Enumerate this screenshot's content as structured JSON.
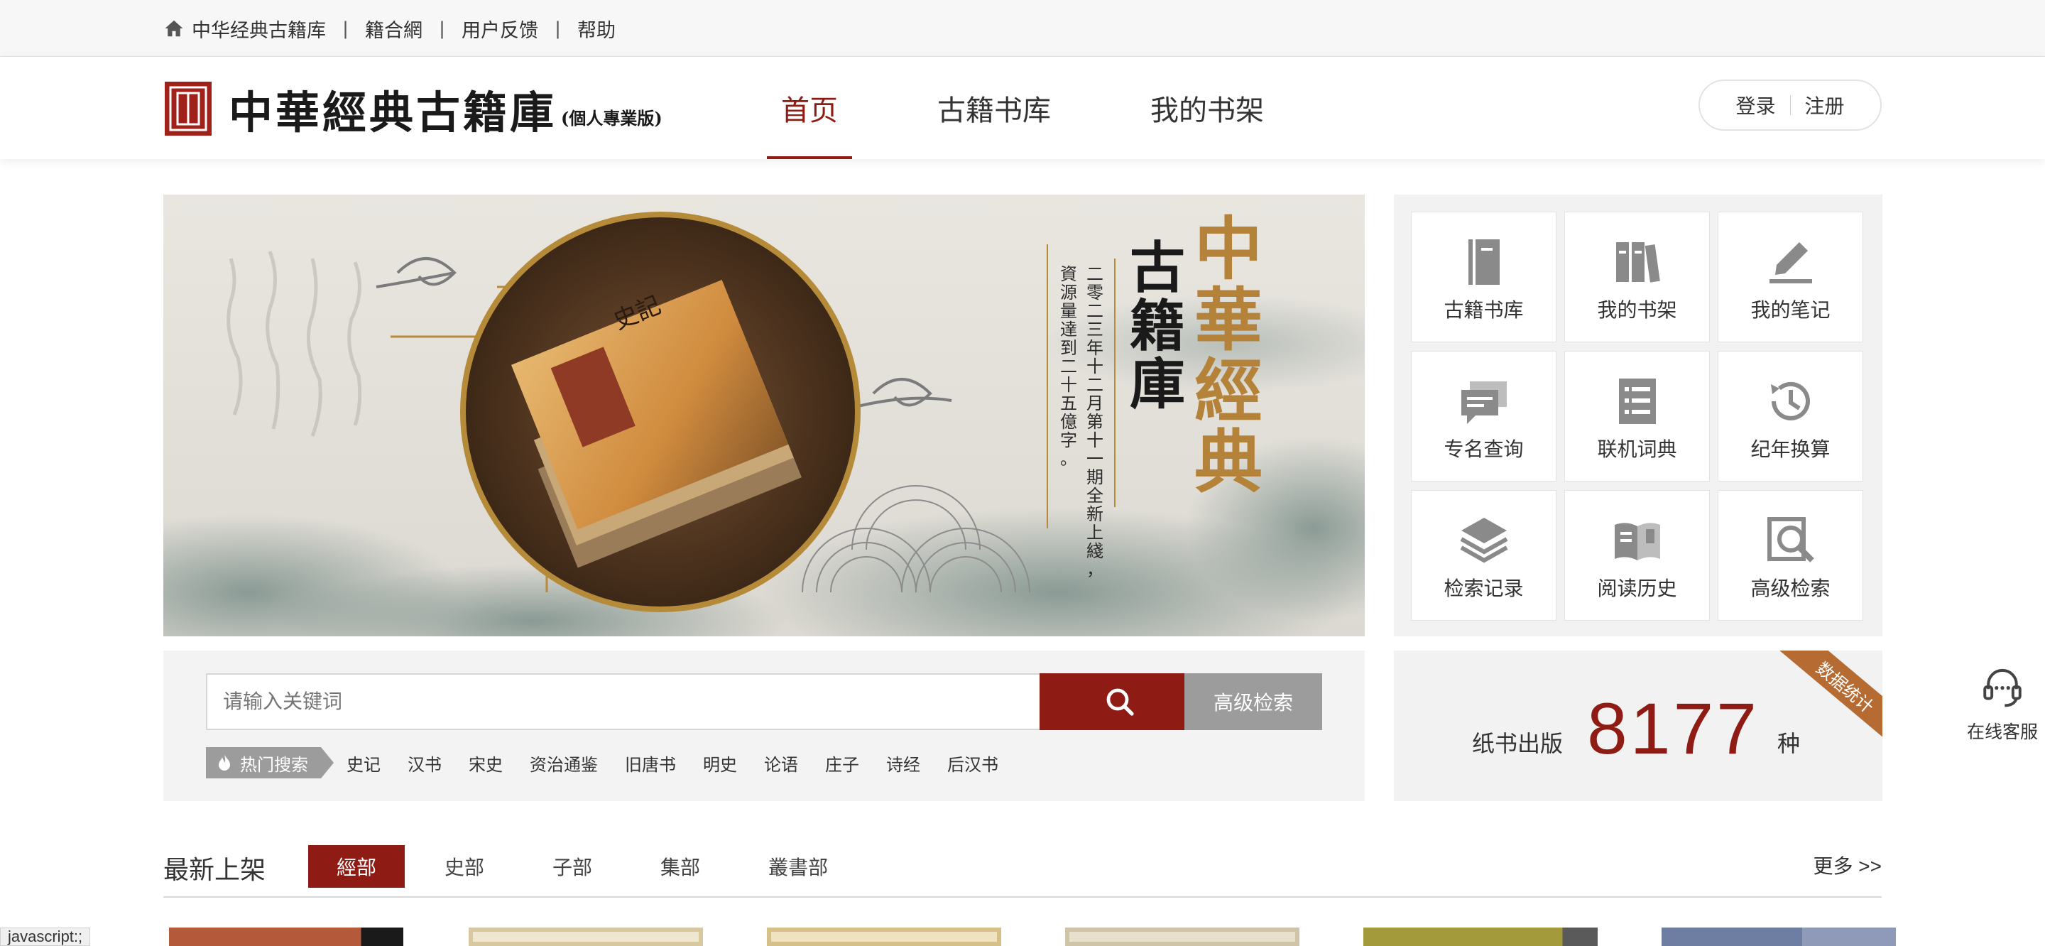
{
  "topbar": {
    "links": [
      "中华经典古籍库",
      "籍合網",
      "用户反馈",
      "帮助"
    ],
    "separator": "|"
  },
  "header": {
    "logo_text": "中華經典古籍庫",
    "logo_sub": "(個人專業版)",
    "nav": [
      {
        "label": "首页",
        "active": true
      },
      {
        "label": "古籍书库",
        "active": false
      },
      {
        "label": "我的书架",
        "active": false
      }
    ],
    "login": "登录",
    "register": "注册"
  },
  "banner": {
    "title_large": [
      "中",
      "華",
      "經",
      "典"
    ],
    "title_mid": [
      "古",
      "籍",
      "庫"
    ],
    "caption_col1": "二零二三年十二月第十一期全新上綫，",
    "caption_col2": "資源量達到二十五億字。",
    "book_label": "史記"
  },
  "search": {
    "placeholder": "请输入关键词",
    "advanced_label": "高级检索",
    "hot_label": "热门搜索",
    "hot_items": [
      "史记",
      "汉书",
      "宋史",
      "资治通鉴",
      "旧唐书",
      "明史",
      "论语",
      "庄子",
      "诗经",
      "后汉书"
    ]
  },
  "quick_tiles": [
    {
      "label": "古籍书库",
      "icon": "book-icon"
    },
    {
      "label": "我的书架",
      "icon": "bookshelf-icon"
    },
    {
      "label": "我的笔记",
      "icon": "note-pen-icon"
    },
    {
      "label": "专名查询",
      "icon": "chat-bubbles-icon"
    },
    {
      "label": "联机词典",
      "icon": "dictionary-icon"
    },
    {
      "label": "纪年换算",
      "icon": "history-clock-icon"
    },
    {
      "label": "检索记录",
      "icon": "layers-icon"
    },
    {
      "label": "阅读历史",
      "icon": "open-book-icon"
    },
    {
      "label": "高级检索",
      "icon": "search-document-icon"
    }
  ],
  "stats": {
    "ribbon": "数据统计",
    "label": "纸书出版",
    "value": "8177",
    "unit": "种"
  },
  "service": {
    "label": "在线客服"
  },
  "latest": {
    "title": "最新上架",
    "tabs": [
      {
        "label": "經部",
        "active": true
      },
      {
        "label": "史部",
        "active": false
      },
      {
        "label": "子部",
        "active": false
      },
      {
        "label": "集部",
        "active": false
      },
      {
        "label": "叢書部",
        "active": false
      }
    ],
    "more": "更多 >>"
  },
  "status_hint": "javascript:;",
  "colors": {
    "accent": "#8e1b14",
    "gray_button": "#9c9c9c",
    "ribbon": "#b66b32"
  }
}
